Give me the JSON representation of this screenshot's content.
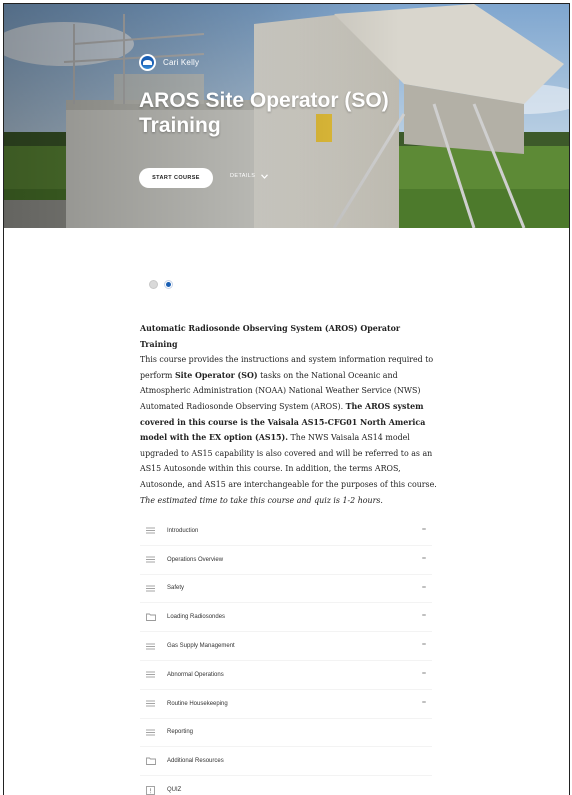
{
  "hero": {
    "author": "Cari Kelly",
    "title": "AROS Site Operator (SO) Training",
    "start_label": "START COURSE",
    "details_label": "DETAILS"
  },
  "description": {
    "heading": "Automatic Radiosonde Observing System (AROS) Operator Training",
    "seg1": "This course provides the instructions and system information required to perform ",
    "seg2": "Site Operator (SO)",
    "seg3": " tasks on the National Oceanic and Atmospheric Administration (NOAA) National Weather Service (NWS) Automated Radiosonde Observing System (AROS). ",
    "seg4": "The AROS system covered in this course is the Vaisala AS15-CFG01 North America model with the EX option (AS15).",
    "seg5": " The NWS Vaisala AS14 model upgraded to AS15 capability is also covered and will be referred to as an AS15 Autosonde within this course. In addition, the terms AROS, Autosonde, and AS15 are interchangeable for the purposes of this course.",
    "estimate": "The estimated time to take this course and quiz is 1-2 hours."
  },
  "lessons": [
    {
      "label": "Introduction",
      "icon": "list-icon"
    },
    {
      "label": "Operations Overview",
      "icon": "list-icon"
    },
    {
      "label": "Safety",
      "icon": "list-icon"
    },
    {
      "label": "Loading Radiosondes",
      "icon": "folder-icon"
    },
    {
      "label": "Gas Supply Management",
      "icon": "list-icon"
    },
    {
      "label": "Abnormal Operations",
      "icon": "list-icon"
    },
    {
      "label": "Routine Housekeeping",
      "icon": "list-icon"
    },
    {
      "label": "Reporting",
      "icon": "list-icon"
    },
    {
      "label": "Additional Resources",
      "icon": "folder-icon"
    },
    {
      "label": "QUIZ",
      "icon": "quiz-icon"
    }
  ],
  "colors": {
    "accent": "#1a5fb4",
    "hero_sky": "#8fb3d6",
    "grass": "#4f7a2e"
  }
}
